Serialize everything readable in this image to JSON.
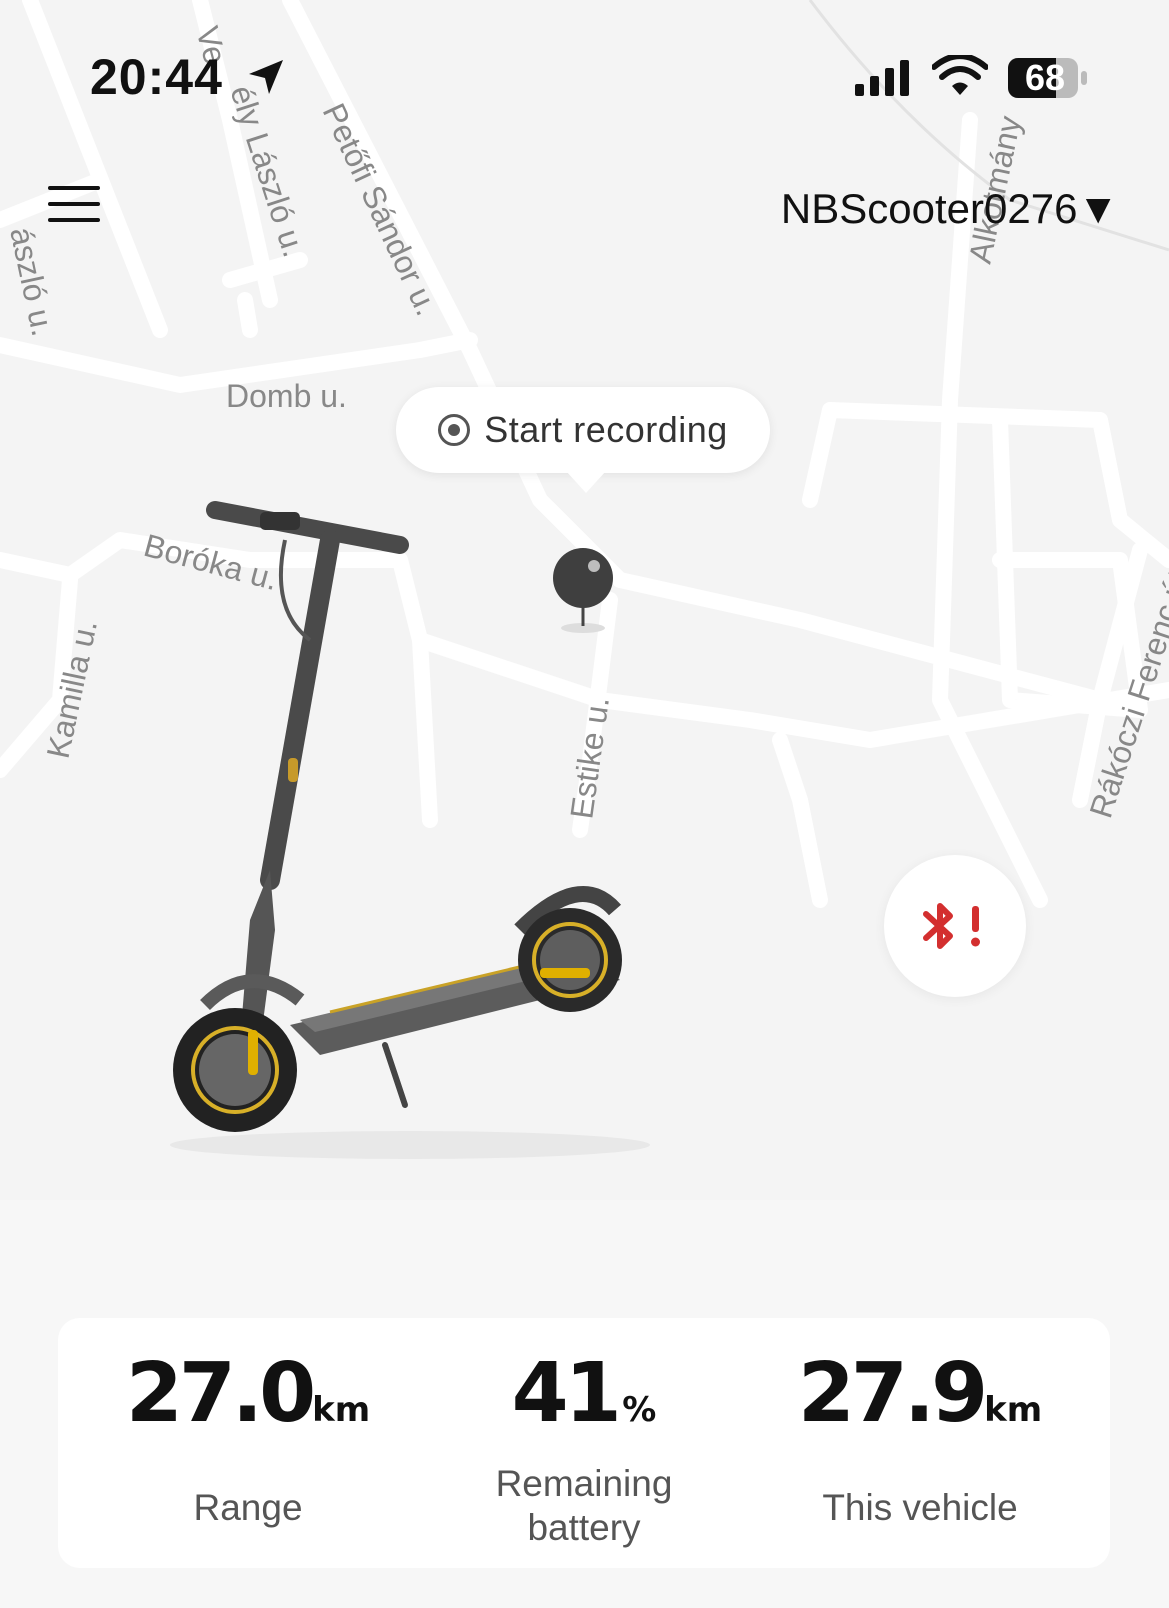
{
  "status_bar": {
    "time": "20:44",
    "battery_percent": "68"
  },
  "header": {
    "device_name": "NBScooter0276▼"
  },
  "map": {
    "streets": [
      "Ve",
      "ély László u.",
      "Petőfi Sándor u.",
      "ászló u.",
      "Domb u.",
      "Boróka u.",
      "Kamilla u.",
      "Estike u.",
      "Alkotmány",
      "Rákóczi Ferenc út"
    ]
  },
  "record": {
    "label": "Start recording"
  },
  "bluetooth": {
    "status": "disconnected",
    "icon": "bluetooth-alert-icon",
    "color": "#d32f2f"
  },
  "stats": [
    {
      "value": "27.0",
      "unit": "km",
      "label": "Range"
    },
    {
      "value": "41",
      "unit": "%",
      "label": "Remaining battery"
    },
    {
      "value": "27.9",
      "unit": "km",
      "label": "This vehicle"
    }
  ],
  "colors": {
    "accent": "#e0b000",
    "bluetooth_warning": "#d32f2f"
  }
}
